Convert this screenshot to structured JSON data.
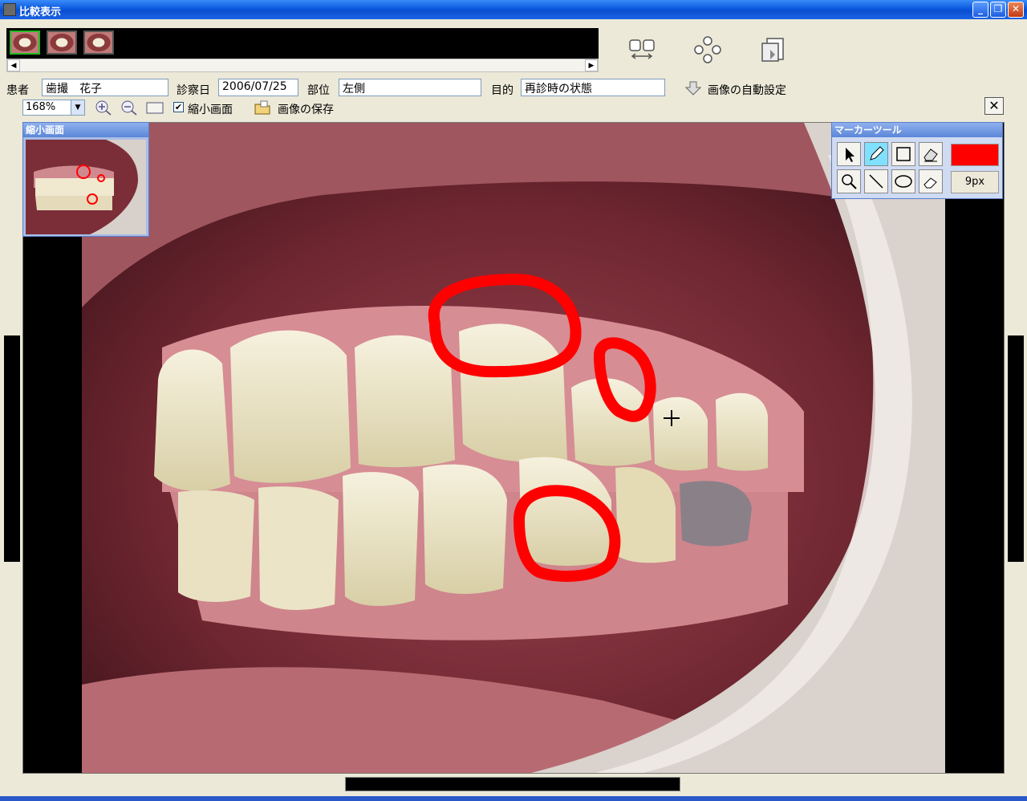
{
  "window": {
    "title": "比較表示",
    "min": "_",
    "max": "❐",
    "close": "✕"
  },
  "thumbnails": {
    "items": [
      "thumb-1",
      "thumb-2",
      "thumb-3"
    ],
    "selected_index": 0
  },
  "scroll": {
    "left": "◀",
    "right": "▶"
  },
  "tools_top": {
    "compare_icon": "side-by-side-compare-icon",
    "layout_icon": "multi-layout-icon",
    "export_icon": "export-icon"
  },
  "info": {
    "patient_label": "患者",
    "patient_value": "歯撮　花子",
    "date_label": "診察日",
    "date_value": "2006/07/25",
    "region_label": "部位",
    "region_value": "左側",
    "purpose_label": "目的",
    "purpose_value": "再診時の状態",
    "auto_label": "画像の自動設定"
  },
  "toolbar": {
    "zoom_value": "168%",
    "mini_label": "縮小画面",
    "mini_checked": "✔",
    "save_label": "画像の保存",
    "close": "✕"
  },
  "mini_panel": {
    "title": "縮小画面"
  },
  "marker_panel": {
    "title": "マーカーツール",
    "color": "#ff0000",
    "size": "9px"
  },
  "colors": {
    "accent": "#0a5adf",
    "marker": "#ff0000"
  }
}
